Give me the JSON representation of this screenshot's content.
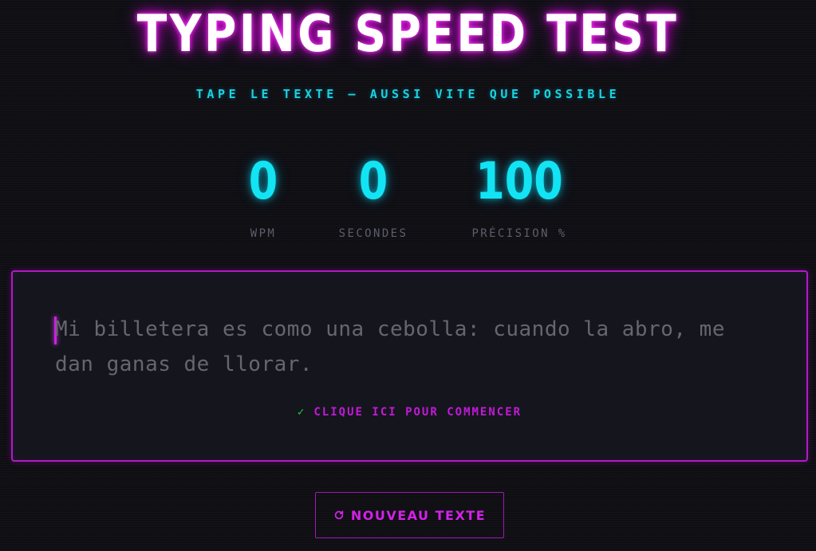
{
  "header": {
    "title": "TYPING SPEED TEST",
    "subtitle": "TAPE LE TEXTE — AUSSI VITE QUE POSSIBLE"
  },
  "stats": [
    {
      "value": "0",
      "label": "WPM"
    },
    {
      "value": "0",
      "label": "SECONDES"
    },
    {
      "value": "100",
      "label": "PRÉCISION %"
    }
  ],
  "typing_area": {
    "passage": "Mi billetera es como una cebolla: cuando la abro, me dan ganas de llorar.",
    "hint": "CLIQUE ICI POUR COMMENCER",
    "hint_icon": "check-icon"
  },
  "actions": {
    "new_text_label": "NOUVEAU TEXTE",
    "new_text_icon": "refresh-icon"
  },
  "colors": {
    "background": "#0e0e13",
    "accent_magenta": "#c21ad6",
    "accent_cyan": "#12e4f4",
    "success_green": "#22d33a",
    "muted_text": "#66666f"
  }
}
